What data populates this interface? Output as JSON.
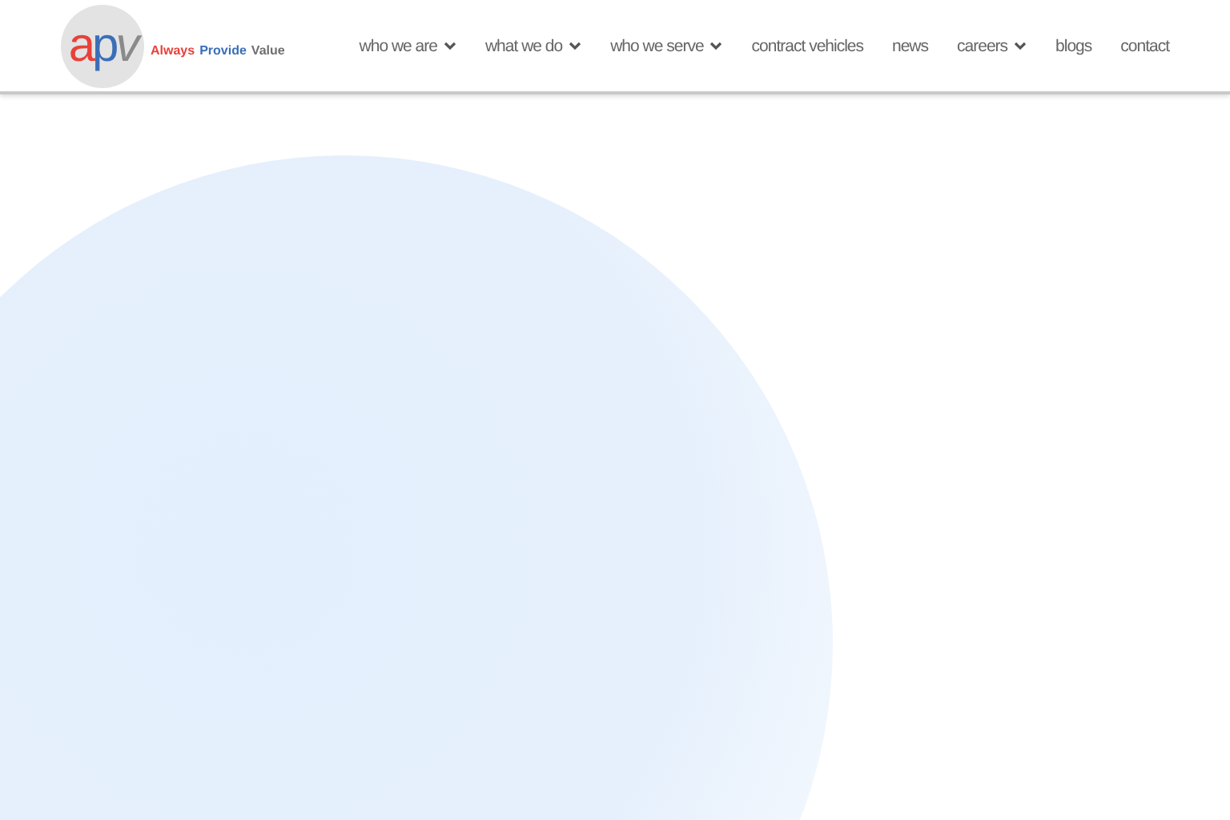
{
  "logo": {
    "letters": [
      {
        "text": "a",
        "color": "#e8413a"
      },
      {
        "text": "p",
        "color": "#3a6fb8"
      },
      {
        "text": "v",
        "color": "#8a8a8a"
      }
    ],
    "tagline": [
      {
        "text": "Always",
        "color": "#e8413a"
      },
      {
        "text": "Provide",
        "color": "#3a6fb8"
      },
      {
        "text": "Value",
        "color": "#6f6f6f"
      }
    ]
  },
  "nav": [
    {
      "label": "who we are",
      "kind": "dropdown"
    },
    {
      "label": "what we do",
      "kind": "dropdown"
    },
    {
      "label": "who we serve",
      "kind": "dropdown"
    },
    {
      "label": "contract vehicles",
      "kind": "link"
    },
    {
      "label": "news",
      "kind": "link"
    },
    {
      "label": "careers",
      "kind": "dropdown"
    },
    {
      "label": "blogs",
      "kind": "link"
    },
    {
      "label": "contact",
      "kind": "link"
    }
  ]
}
